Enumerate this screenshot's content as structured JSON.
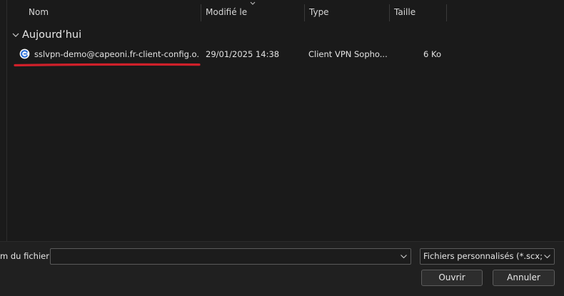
{
  "columns": {
    "name": "Nom",
    "modified": "Modifié le",
    "type": "Type",
    "size": "Taille"
  },
  "group": {
    "label": "Aujourd’hui"
  },
  "files": [
    {
      "name": "sslvpn-demo@capeoni.fr-client-config.o...",
      "modified": "29/01/2025 14:38",
      "type": "Client VPN Sopho...",
      "size": "6 Ko",
      "icon": "sophos-connect-icon"
    }
  ],
  "bottom": {
    "filename_label": "m du fichier :",
    "filename_value": "",
    "filter_value": "Fichiers personnalisés (*.scx;*.tgb",
    "open_label": "Ouvrir",
    "cancel_label": "Annuler"
  },
  "colors": {
    "background": "#1f1f1f",
    "annotation": "#d0202a",
    "icon_blue": "#2b6fd6"
  }
}
